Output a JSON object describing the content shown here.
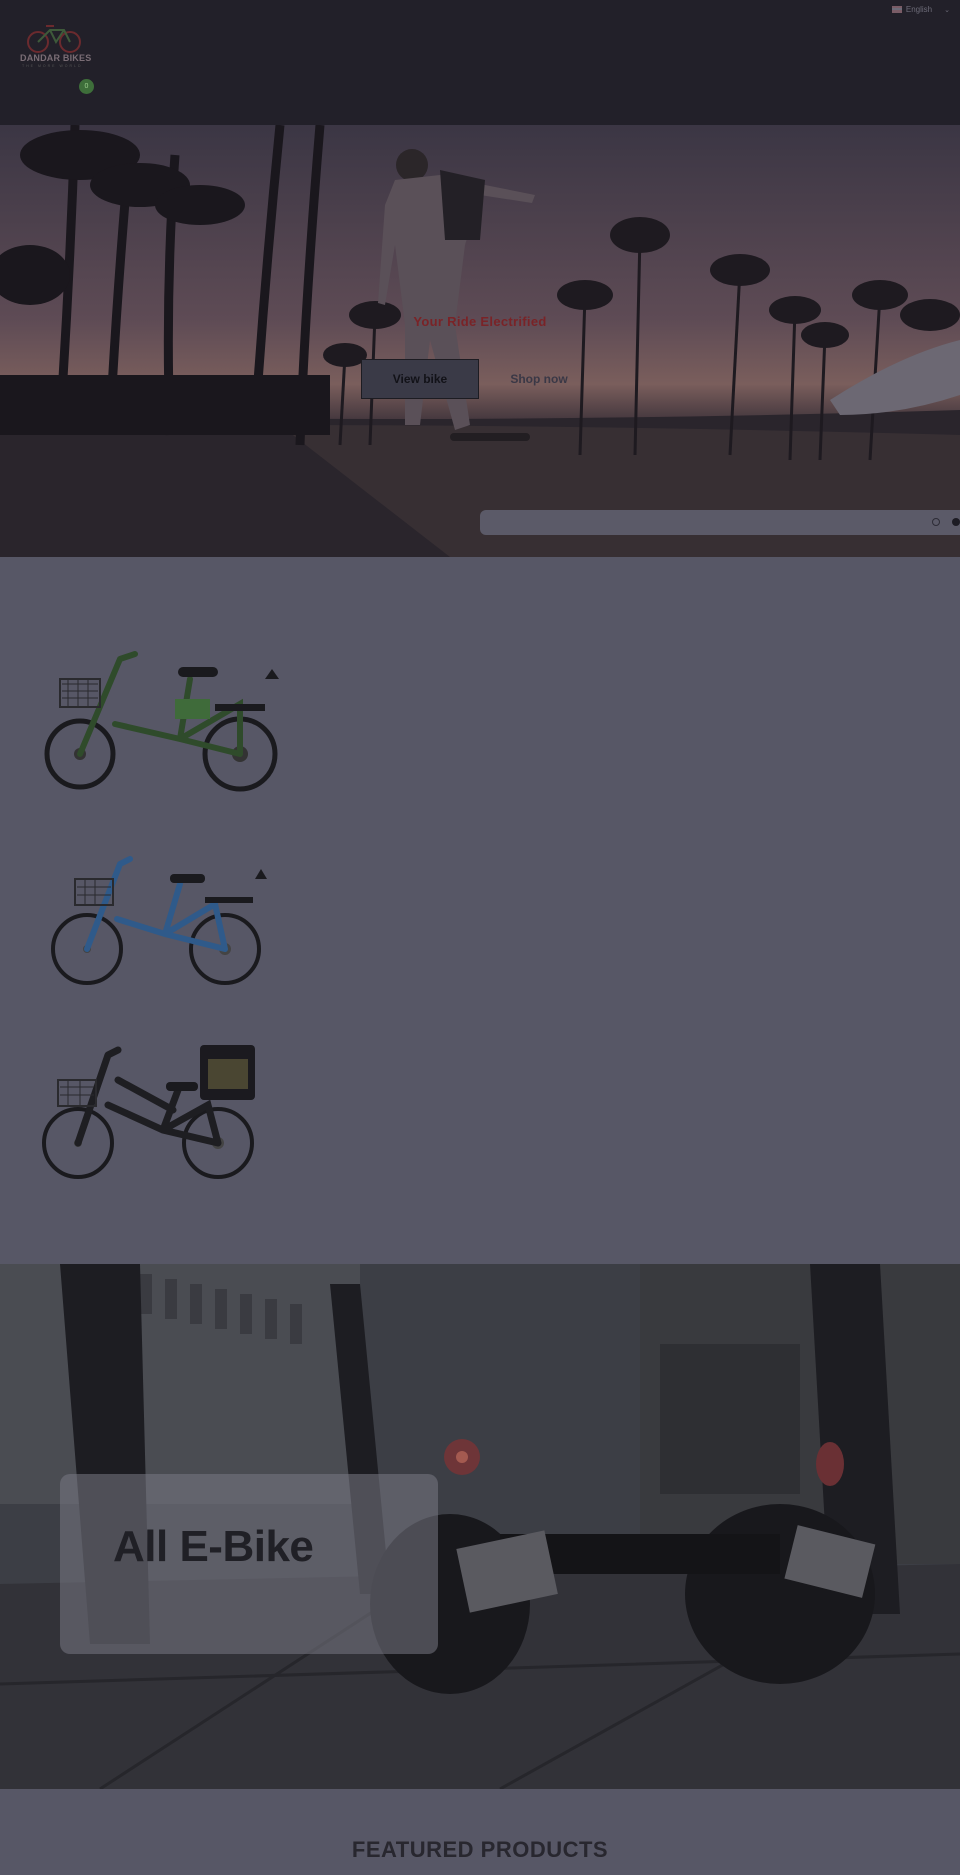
{
  "header": {
    "logo_text": "DANDAR BIKES",
    "logo_sub": "THE MORE WORLD",
    "language": "English",
    "cart_count": "0",
    "icons": [
      "flag-us-icon",
      "chevron-down-icon",
      "logo-bike-icon"
    ]
  },
  "hero": {
    "title": "Your Ride Electrified",
    "view_button": "View bike",
    "shop_button": "Shop now",
    "slides_total": 2,
    "slide_active": 2
  },
  "bikes": [
    {
      "name": "green-ebike",
      "color": "#3f6b3a"
    },
    {
      "name": "blue-ebike",
      "color": "#2f5a8a"
    },
    {
      "name": "black-delivery-ebike",
      "color": "#1e1e22"
    }
  ],
  "banner": {
    "title": "All E-Bike"
  },
  "featured": {
    "title": "FEATURED PRODUCTS"
  },
  "colors": {
    "header_bg": "#222029",
    "page_bg": "#575766",
    "accent_red": "#7a2327",
    "cart_green": "#3e6e3a"
  }
}
